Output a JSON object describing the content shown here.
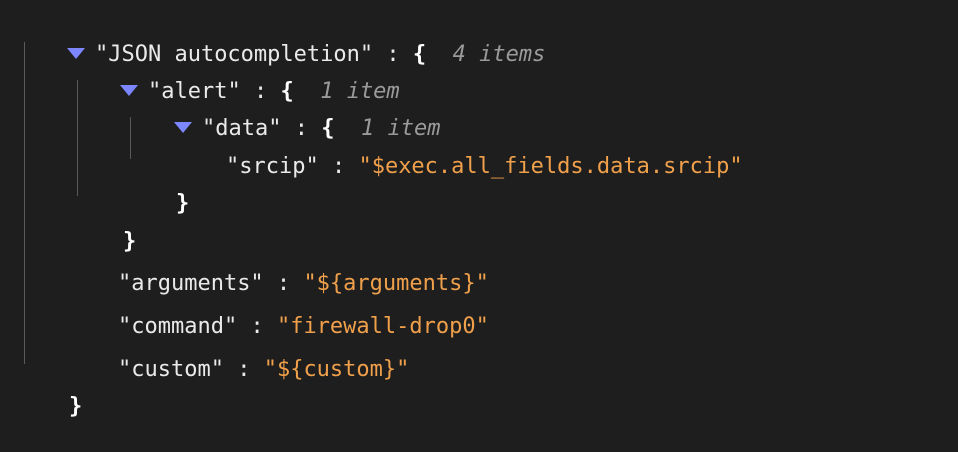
{
  "root": {
    "key": "\"JSON autocompletion\"",
    "colon": " : ",
    "open": "{",
    "count": "4 items",
    "close": "}"
  },
  "alert": {
    "key": "\"alert\"",
    "colon": " : ",
    "open": "{",
    "count": "1 item",
    "close": "}"
  },
  "data": {
    "key": "\"data\"",
    "colon": " : ",
    "open": "{",
    "count": "1 item",
    "close": "}"
  },
  "srcip": {
    "key": "\"srcip\"",
    "colon": " : ",
    "value": "\"$exec.all_fields.data.srcip\""
  },
  "arguments": {
    "key": "\"arguments\"",
    "colon": " : ",
    "value": "\"${arguments}\""
  },
  "command": {
    "key": "\"command\"",
    "colon": " : ",
    "value": "\"firewall-drop0\""
  },
  "custom": {
    "key": "\"custom\"",
    "colon": " : ",
    "value": "\"${custom}\""
  },
  "colors": {
    "background": "#1e1e1e",
    "toggle": "#7b86ff",
    "string": "#f0a04b",
    "count": "#9a9a9a"
  }
}
